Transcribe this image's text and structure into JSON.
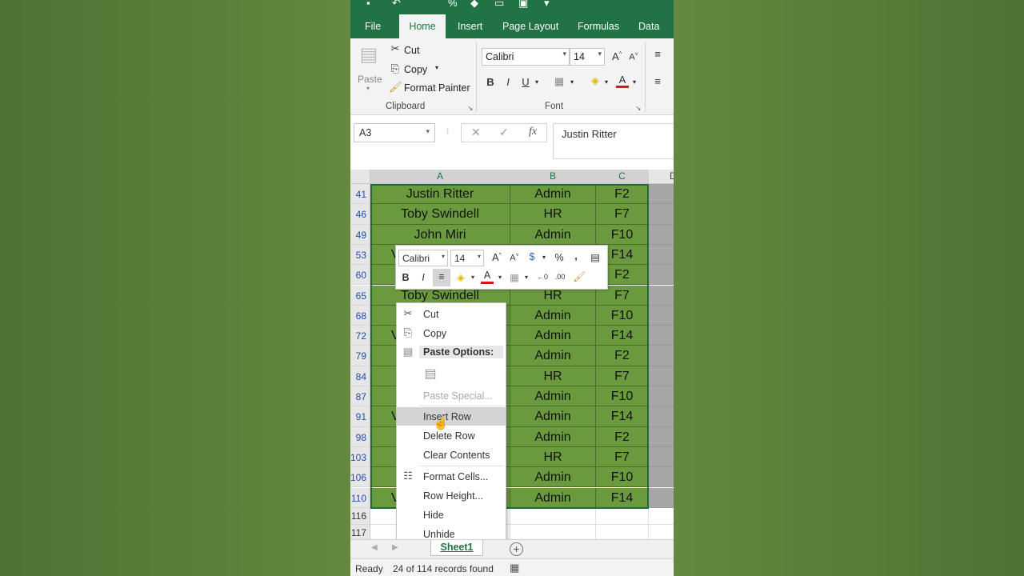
{
  "ribbon": {
    "tabs": [
      "File",
      "Home",
      "Insert",
      "Page Layout",
      "Formulas",
      "Data"
    ],
    "active_tab": "Home",
    "clipboard": {
      "paste_label": "Paste",
      "cut_label": "Cut",
      "copy_label": "Copy",
      "format_painter_label": "Format Painter",
      "group_label": "Clipboard"
    },
    "font": {
      "family": "Calibri",
      "size": "14",
      "group_label": "Font",
      "bold": "B",
      "italic": "I",
      "underline": "U"
    }
  },
  "formula_bar": {
    "name_box": "A3",
    "content": "Justin Ritter",
    "fx": "fx",
    "cancel": "✕",
    "enter": "✓"
  },
  "grid": {
    "columns": [
      "A",
      "B",
      "C",
      "D"
    ],
    "rows": [
      {
        "num": "41",
        "a": "Justin Ritter",
        "b": "Admin",
        "c": "F2"
      },
      {
        "num": "46",
        "a": "Toby Swindell",
        "b": "HR",
        "c": "F7"
      },
      {
        "num": "49",
        "a": "John Miri",
        "b": "Admin",
        "c": "F10"
      },
      {
        "num": "53",
        "a": "V",
        "b": "Admin",
        "c": "F14"
      },
      {
        "num": "60",
        "a": "",
        "b": "Admin",
        "c": "F2"
      },
      {
        "num": "65",
        "a": "Toby Swindell",
        "b": "HR",
        "c": "F7"
      },
      {
        "num": "68",
        "a": "",
        "b": "Admin",
        "c": "F10"
      },
      {
        "num": "72",
        "a": "V",
        "b": "Admin",
        "c": "F14"
      },
      {
        "num": "79",
        "a": "",
        "b": "Admin",
        "c": "F2"
      },
      {
        "num": "84",
        "a": "",
        "b": "HR",
        "c": "F7"
      },
      {
        "num": "87",
        "a": "",
        "b": "Admin",
        "c": "F10"
      },
      {
        "num": "91",
        "a": "V",
        "b": "Admin",
        "c": "F14"
      },
      {
        "num": "98",
        "a": "",
        "b": "Admin",
        "c": "F2"
      },
      {
        "num": "103",
        "a": "",
        "b": "HR",
        "c": "F7"
      },
      {
        "num": "106",
        "a": "",
        "b": "Admin",
        "c": "F10"
      },
      {
        "num": "110",
        "a": "V",
        "b": "Admin",
        "c": "F14"
      }
    ],
    "blank_rows": [
      "116",
      "117"
    ],
    "colors": {
      "highlight": "#6b9a3e",
      "selection": "#1d6b3a"
    }
  },
  "mini_toolbar": {
    "font": "Calibri",
    "size": "14",
    "bold": "B",
    "italic": "I",
    "percent": "%",
    "comma": ","
  },
  "context_menu": {
    "items": [
      {
        "label": "Cut"
      },
      {
        "label": "Copy"
      },
      {
        "label": "Paste Options:"
      },
      {
        "label": "Paste Special..."
      },
      {
        "label": "Insert Row"
      },
      {
        "label": "Delete Row"
      },
      {
        "label": "Clear Contents"
      },
      {
        "label": "Format Cells..."
      },
      {
        "label": "Row Height..."
      },
      {
        "label": "Hide"
      },
      {
        "label": "Unhide"
      }
    ]
  },
  "sheets": {
    "active": "Sheet1"
  },
  "status": {
    "ready": "Ready",
    "records": "24 of 114 records found"
  },
  "brand_color": "#217346"
}
